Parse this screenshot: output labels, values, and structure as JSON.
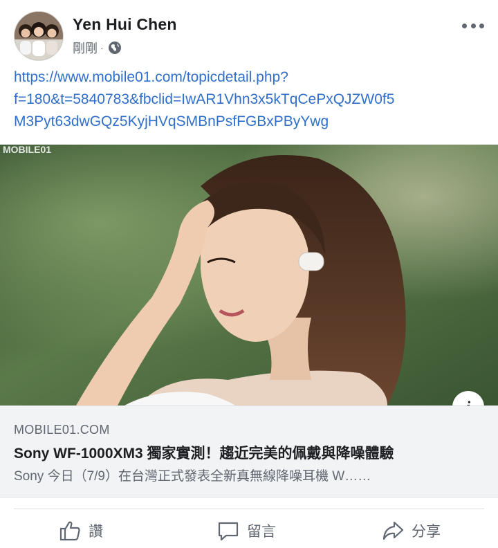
{
  "post": {
    "author": "Yen Hui Chen",
    "timestamp": "剛剛",
    "separator": "·",
    "privacy_icon": "globe-icon",
    "text_lines": [
      "https://www.mobile01.com/topicdetail.php?",
      "f=180&t=5840783&fbclid=IwAR1Vhn3x5kTqCePxQJZW0f5",
      "M3Pyt63dwGQz5KyjHVqSMBnPsfFGBxPByYwg"
    ]
  },
  "link_preview": {
    "image_watermark": "MOBILE01",
    "info_label": "i",
    "domain": "MOBILE01.COM",
    "title": "Sony WF-1000XM3 獨家實測！趨近完美的佩戴與降噪體驗",
    "description": "Sony 今日（7/9）在台灣正式發表全新真無線降噪耳機 W……"
  },
  "actions": {
    "like": "讚",
    "comment": "留言",
    "share": "分享"
  },
  "colors": {
    "link": "#2f6fc9",
    "secondary_text": "#606770",
    "preview_bg": "#f2f3f5"
  }
}
